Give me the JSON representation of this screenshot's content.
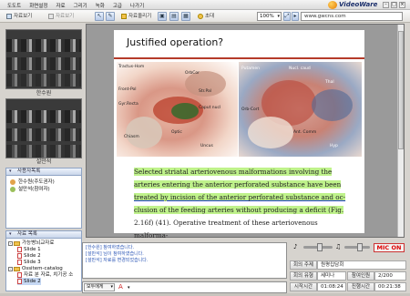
{
  "app": {
    "brand": "VideoWare"
  },
  "menu": [
    "도도트",
    "화면설정",
    "자료",
    "그리기",
    "녹화",
    "고급",
    "나가기"
  ],
  "toolbar": {
    "btn1": "자료보기",
    "btn2": "자료보기",
    "btn3": "자료올리기",
    "btn4": "초대",
    "zoom": "100%",
    "url": "www.gwcns.com"
  },
  "videos": [
    {
      "caption": "한수원"
    },
    {
      "caption": "설만석"
    }
  ],
  "users": {
    "header": "사용자목록",
    "list": [
      "한수원(주도권자)",
      "설만석(참여자)"
    ]
  },
  "files": {
    "header": "자료 목록",
    "tree": [
      {
        "label": "가능병뇌교자료",
        "type": "folder",
        "expand": "-"
      },
      {
        "label": "Slide 1",
        "type": "slide"
      },
      {
        "label": "Slide 2",
        "type": "slide"
      },
      {
        "label": "Slide 3",
        "type": "slide"
      },
      {
        "label": "Ossitem-catalog",
        "type": "folder",
        "expand": "-"
      },
      {
        "label": "자료 분 자료, 치기공 소",
        "type": "slide"
      },
      {
        "label": "Slide 2",
        "type": "slide",
        "selected": true
      }
    ]
  },
  "slide": {
    "title": "Justified operation?",
    "labels_left": [
      "Tractus-Hom",
      "OrbCor",
      "Str.Pal",
      "Front-Pol",
      "Gyr.Recta",
      "Caput nucl",
      "Chiasm",
      "Optic",
      "Uncus"
    ],
    "labels_right": [
      "Putamen",
      "Nucl. caud",
      "Thal",
      "Orb-Cort",
      "Ant. Comm",
      "Hyp"
    ],
    "text": [
      {
        "t": "Selected striatal arteriovenous malformations involving the",
        "hl": true
      },
      {
        "t": "arteries entering the anterior perforated substance have been",
        "hl": true
      },
      {
        "t": "treated by incision of the anterior perforated substance and oc-",
        "hl": true
      },
      {
        "t": "clusion of the feeding arteries without producing a deficit (Fig.",
        "hl": true
      },
      {
        "t": "2.16f) (41). Operative treatment of these arteriovenous malforma-",
        "hl": false
      }
    ]
  },
  "chat": {
    "lines": [
      "[한수원] 참여하였습니다.",
      "[설만석] 님이 참여하였습니다.",
      "[설만석] 자료를 변경되었습니다."
    ],
    "recipient": "모두에게"
  },
  "info": {
    "mic": "MIC ON",
    "rows": [
      {
        "label": "회의 주제",
        "value": "원평집담회"
      },
      {
        "label": "회의 유형",
        "value": "세미나",
        "label2": "참여인원",
        "value2": "2/200"
      },
      {
        "label": "시작시간",
        "value": "01:08:24",
        "label2": "진행시간",
        "value2": "00:21:38"
      }
    ]
  },
  "colors": {
    "highlight": "#bff28b",
    "mic": "#dd0000",
    "accent": "#1a2e6b"
  }
}
